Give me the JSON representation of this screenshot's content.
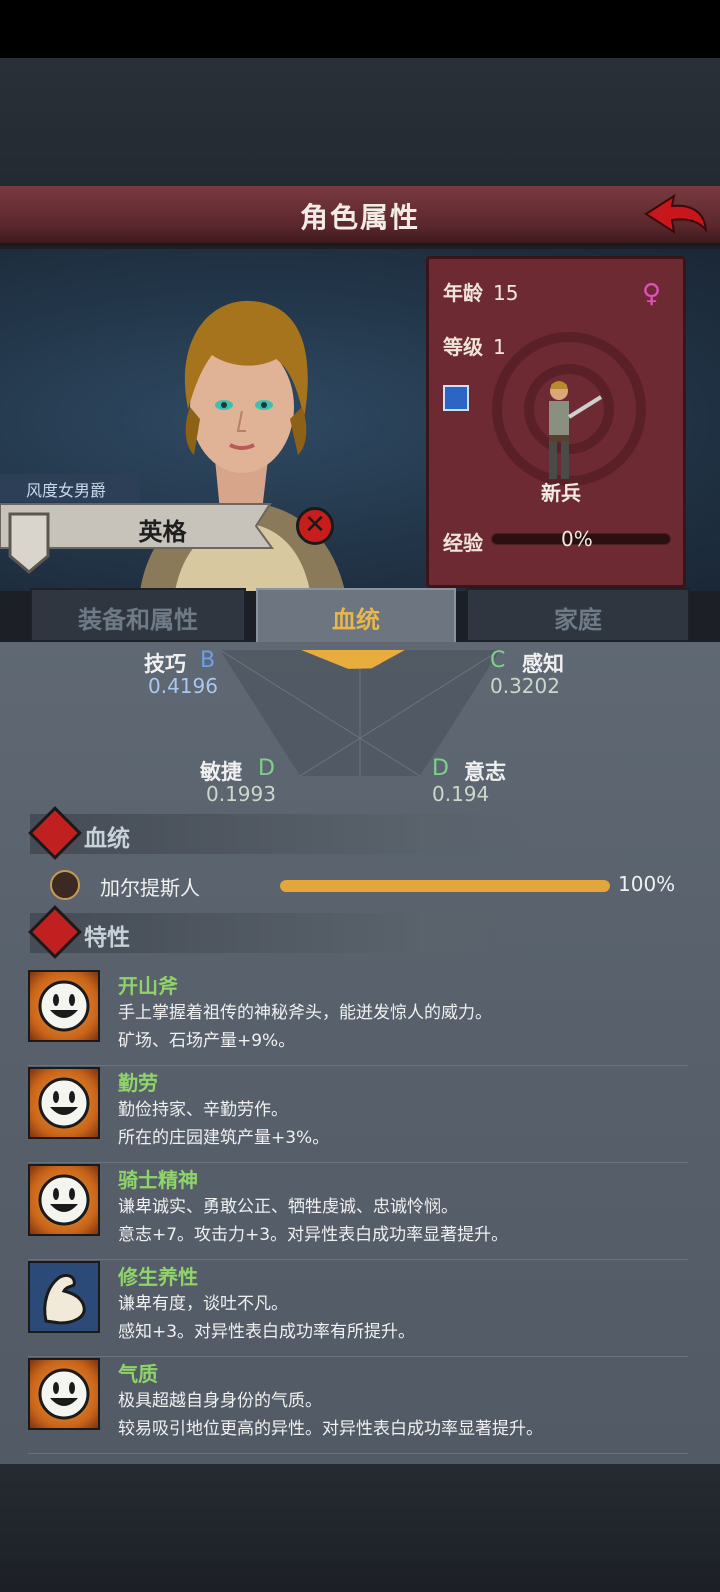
{
  "header": {
    "title": "角色属性",
    "back_icon": "back-arrow-icon"
  },
  "character": {
    "title": "风度女男爵",
    "name": "英格",
    "age_label": "年龄",
    "age": "15",
    "level_label": "等级",
    "level": "1",
    "gender_icon": "female-icon",
    "unit_type": "新兵",
    "exp_label": "经验",
    "exp": "0%",
    "exp_fraction": 0
  },
  "tabs": [
    {
      "label": "装备和属性",
      "active": false
    },
    {
      "label": "血统",
      "active": true
    },
    {
      "label": "家庭",
      "active": false
    }
  ],
  "attributes": [
    {
      "name": "技巧",
      "grade": "B",
      "value": "0.4196"
    },
    {
      "name": "感知",
      "grade": "C",
      "value": "0.3202"
    },
    {
      "name": "敏捷",
      "grade": "D",
      "value": "0.1993"
    },
    {
      "name": "意志",
      "grade": "D",
      "value": "0.194"
    }
  ],
  "bloodline": {
    "section_title": "血统",
    "race": "加尔提斯人",
    "percent": "100%",
    "fraction": 1.0
  },
  "traits_section": {
    "title": "特性"
  },
  "traits": [
    {
      "name": "开山斧",
      "icon": "smiley-icon",
      "lines": [
        "手上掌握着祖传的神秘斧头，能迸发惊人的威力。",
        "矿场、石场产量+9%。"
      ]
    },
    {
      "name": "勤劳",
      "icon": "smiley-icon",
      "lines": [
        "勤俭持家、辛勤劳作。",
        "所在的庄园建筑产量+3%。"
      ]
    },
    {
      "name": "骑士精神",
      "icon": "smiley-icon",
      "lines": [
        "谦卑诚实、勇敢公正、牺牲虔诚、忠诚怜悯。",
        "意志+7。攻击力+3。对异性表白成功率显著提升。"
      ]
    },
    {
      "name": "修生养性",
      "icon": "flexed-arm-icon",
      "lines": [
        "谦卑有度，谈吐不凡。",
        "感知+3。对异性表白成功率有所提升。"
      ]
    },
    {
      "name": "气质",
      "icon": "smiley-icon",
      "lines": [
        "极具超越自身身份的气质。",
        "较易吸引地位更高的异性。对异性表白成功率显著提升。"
      ]
    }
  ],
  "colors": {
    "accent_gold": "#e8b64a",
    "panel_red": "#6e2a33",
    "trait_green": "#8fd46a",
    "grade_blue": "#6aa0e8",
    "grade_green": "#7fd18a"
  }
}
